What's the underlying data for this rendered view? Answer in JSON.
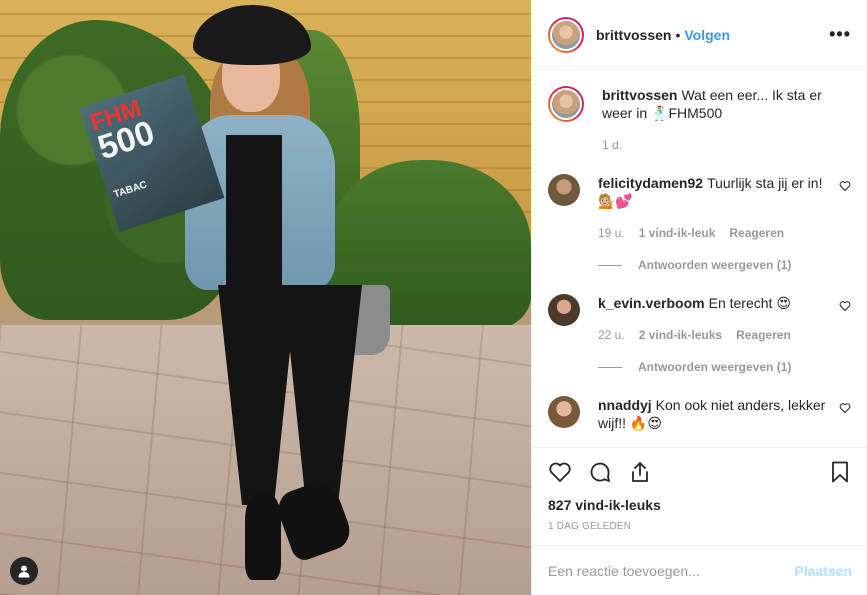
{
  "post": {
    "username": "brittvossen",
    "follow_label": "Volgen",
    "separator": "•",
    "more_label": "•••",
    "magazine": {
      "title": "FHM",
      "number": "500",
      "sub": "TABAC"
    }
  },
  "caption": {
    "username": "brittvossen",
    "text": "Wat een eer... Ik sta er weer in 🕺FHM500",
    "time": "1 d."
  },
  "comments": [
    {
      "username": "felicitydamen92",
      "text": "Tuurlijk sta jij er in! 💁🏼💕",
      "time": "19 u.",
      "likes": "1 vind-ik-leuk",
      "reply_label": "Reageren",
      "view_replies": "Antwoorden weergeven (1)"
    },
    {
      "username": "k_evin.verboom",
      "text": "En terecht 😍",
      "time": "22 u.",
      "likes": "2 vind-ik-leuks",
      "reply_label": "Reageren",
      "view_replies": "Antwoorden weergeven (1)"
    },
    {
      "username": "nnaddyj",
      "text": "Kon ook niet anders, lekker wijf!! 🔥😍"
    }
  ],
  "actions": {
    "like_icon": "heart-icon",
    "comment_icon": "comment-icon",
    "share_icon": "share-icon",
    "save_icon": "bookmark-icon",
    "likes_count": "827 vind-ik-leuks",
    "date": "1 DAG GELEDEN"
  },
  "add_comment": {
    "placeholder": "Een reactie toevoegen...",
    "post_label": "Plaatsen"
  },
  "colors": {
    "link": "#3897f0",
    "post_disabled": "#b2dffc",
    "muted": "#999999",
    "text": "#262626"
  }
}
